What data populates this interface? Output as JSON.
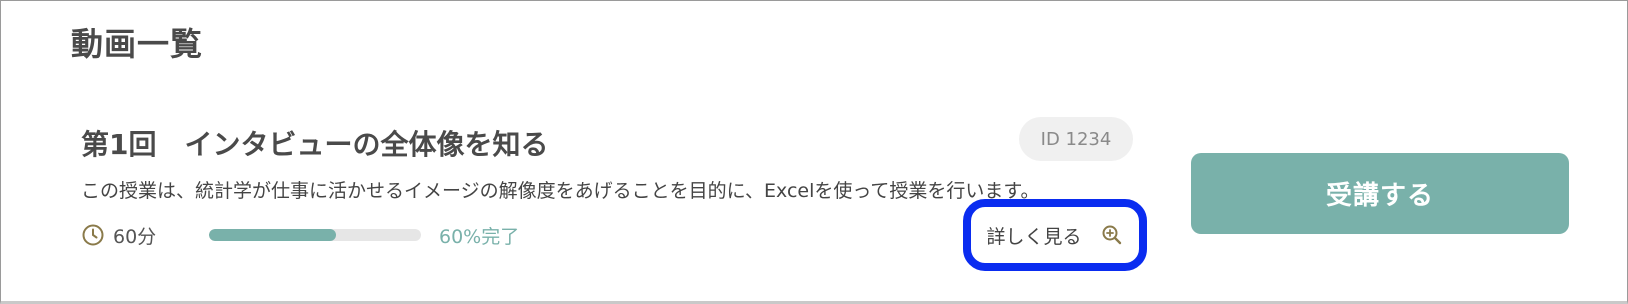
{
  "section": {
    "title": "動画一覧"
  },
  "lesson": {
    "title": "第1回　インタビューの全体像を知る",
    "id_label": "ID 1234",
    "description": "この授業は、統計学が仕事に活かせるイメージの解像度をあげることを目的に、Excelを使って授業を行います。",
    "duration": "60分",
    "progress_percent": 60,
    "progress_label": "60%完了",
    "details_label": "詳しく見る",
    "enroll_label": "受講する"
  },
  "icons": {
    "duration": "clock-icon",
    "details": "zoom-in-icon"
  },
  "colors": {
    "accent": "#79b1aa",
    "highlight_border": "#0a2cf0",
    "icon_brown": "#8a7a4a",
    "text": "#444444"
  }
}
